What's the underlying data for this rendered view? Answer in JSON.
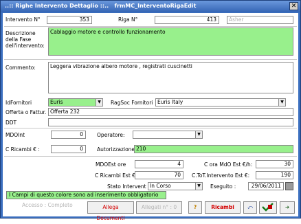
{
  "window": {
    "title": "..:: Righe Intervento Dettaglio ::..   frmMC_InterventoRigaEdit",
    "close_glyph": "✕"
  },
  "header": {
    "intervento_label": "Intervento N°",
    "intervento_value": "353",
    "riga_label": "Riga N°",
    "riga_value": "413",
    "user_value": "Asher"
  },
  "descrizione": {
    "label": "Descrizione della Fase dell'intervento:",
    "value": "Cablaggio motore e controllo funzionamento"
  },
  "commento": {
    "label": "Commento:",
    "value": "Leggera vibrazione albero motore , registrati cuscinetti"
  },
  "fornitore": {
    "id_label": "IdFornitori",
    "id_value": "Euris",
    "ragsoc_label": "RagSoc Fornitori",
    "ragsoc_value": "Euris Italy"
  },
  "offerta": {
    "label": "Offerta o Fattur.",
    "value": "Offerta  232"
  },
  "ddt": {
    "label": "DDT",
    "value": ""
  },
  "mdoint": {
    "label": "MDOInt",
    "value": "0",
    "operatore_label": "Operatore:",
    "operatore_value": ""
  },
  "ricambi": {
    "label": "C  Ricambi € :",
    "value": "0",
    "autorizzazione_label": "Autorizzazione:",
    "autorizzazione_value": "210"
  },
  "costi": {
    "mdoest_label": "MDOEst ore",
    "mdoest_value": "4",
    "cora_label": "C ora MdO Est  €/h:",
    "cora_value": "30",
    "ricest_label": "C  Ricambi Est €:",
    "ricest_value": "70",
    "ctot_label": "C.ToT.Intervento Est €:",
    "ctot_value": "190"
  },
  "stato": {
    "label": "Stato Intervent",
    "value": "In Corso",
    "eseguito_label": "Eseguito :",
    "eseguito_value": "29/06/2011"
  },
  "note": {
    "required_text": "I Campi di questo colore sono ad inserimento obbligatorio"
  },
  "faint": {
    "text": "Accesso :  Completo"
  },
  "buttons": {
    "allega_label": "Allega Documenti",
    "allegati_label": "Allegati n° :  0",
    "help_glyph": "?",
    "ricambi_label": "Ricambi",
    "undo_glyph": "⤺",
    "exit_glyph": "➜"
  },
  "colors": {
    "required": "#98f08c",
    "titlebar": "#3464b4"
  }
}
